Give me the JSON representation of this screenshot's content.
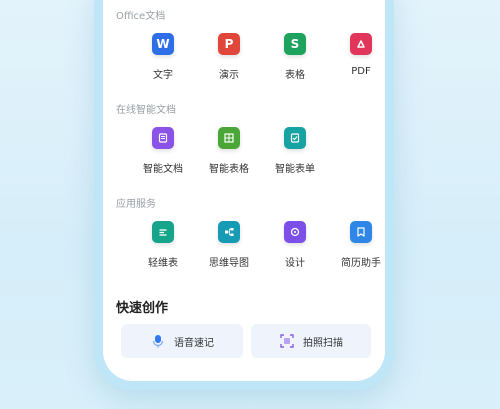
{
  "sections": {
    "office": {
      "title": "Office文档",
      "items": [
        {
          "label": "文字",
          "letter": "W",
          "color": "#2e6ee6"
        },
        {
          "label": "演示",
          "letter": "P",
          "color": "#e0463a"
        },
        {
          "label": "表格",
          "letter": "S",
          "color": "#1ea35f"
        },
        {
          "label": "PDF",
          "letter": "",
          "color": "#e2355c"
        }
      ]
    },
    "online": {
      "title": "在线智能文档",
      "items": [
        {
          "label": "智能文档",
          "color": "#8a52e6"
        },
        {
          "label": "智能表格",
          "color": "#4aa636"
        },
        {
          "label": "智能表单",
          "color": "#17a3a3"
        }
      ]
    },
    "services": {
      "title": "应用服务",
      "items": [
        {
          "label": "轻维表",
          "color": "#16a48a"
        },
        {
          "label": "思维导图",
          "color": "#179ab3"
        },
        {
          "label": "设计",
          "color": "#7b4fe8"
        },
        {
          "label": "简历助手",
          "color": "#2f86e6"
        }
      ]
    }
  },
  "quick": {
    "title": "快速创作",
    "voice_label": "语音速记",
    "scan_label": "拍照扫描",
    "voice_color": "#3478f6",
    "scan_color": "#8a5ce6"
  }
}
